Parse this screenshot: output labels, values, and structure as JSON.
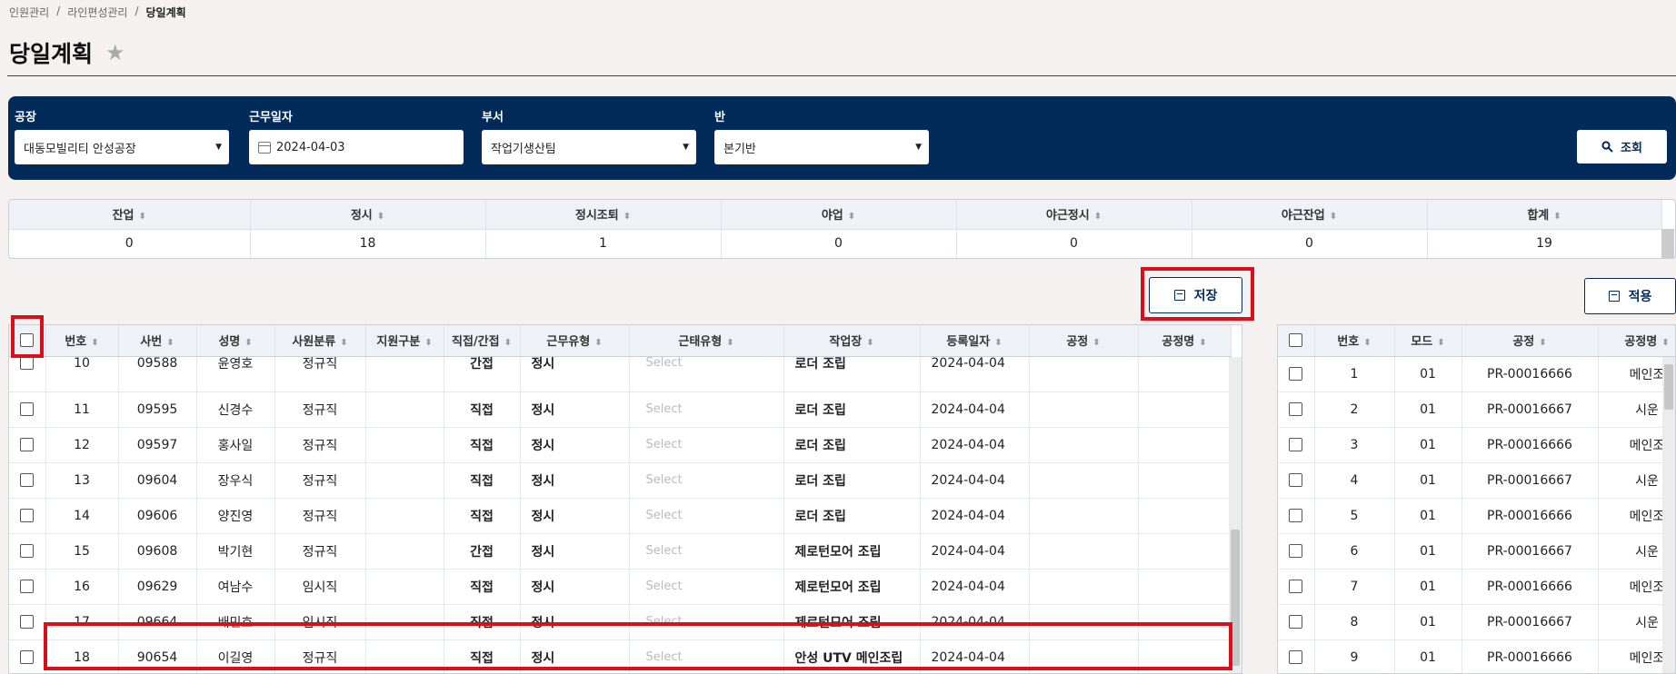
{
  "breadcrumb": [
    "인원관리",
    "라인편성관리",
    "당일계획"
  ],
  "page": {
    "title": "당일계획"
  },
  "filters": {
    "factory": {
      "label": "공장",
      "value": "대동모빌리티 안성공장"
    },
    "work_date": {
      "label": "근무일자",
      "value": "2024-04-03"
    },
    "department": {
      "label": "부서",
      "value": "작업기생산팀"
    },
    "team": {
      "label": "반",
      "value": "본기반"
    },
    "search_label": "조회"
  },
  "summary": {
    "headers": [
      "잔업",
      "정시",
      "정시조퇴",
      "야업",
      "야근정시",
      "야근잔업",
      "합계"
    ],
    "values": [
      "0",
      "18",
      "1",
      "0",
      "0",
      "0",
      "19"
    ]
  },
  "buttons": {
    "save": "저장",
    "apply": "적용"
  },
  "main_table": {
    "headers": [
      "번호",
      "사번",
      "성명",
      "사원분류",
      "지원구분",
      "직접/간접",
      "근무유형",
      "근태유형",
      "작업장",
      "등록일자",
      "공정",
      "공정명"
    ],
    "select_placeholder": "Select",
    "rows": [
      {
        "no": "10",
        "emp_id": "09588",
        "name": "윤영호",
        "class": "정규직",
        "support": "",
        "type": "간접",
        "work": "정시",
        "attend": "Select",
        "workplace": "로더 조립",
        "date": "2024-04-04",
        "proc": "",
        "proc_name": ""
      },
      {
        "no": "11",
        "emp_id": "09595",
        "name": "신경수",
        "class": "정규직",
        "support": "",
        "type": "직접",
        "work": "정시",
        "attend": "Select",
        "workplace": "로더 조립",
        "date": "2024-04-04",
        "proc": "",
        "proc_name": ""
      },
      {
        "no": "12",
        "emp_id": "09597",
        "name": "홍사일",
        "class": "정규직",
        "support": "",
        "type": "직접",
        "work": "정시",
        "attend": "Select",
        "workplace": "로더 조립",
        "date": "2024-04-04",
        "proc": "",
        "proc_name": ""
      },
      {
        "no": "13",
        "emp_id": "09604",
        "name": "장우식",
        "class": "정규직",
        "support": "",
        "type": "직접",
        "work": "정시",
        "attend": "Select",
        "workplace": "로더 조립",
        "date": "2024-04-04",
        "proc": "",
        "proc_name": ""
      },
      {
        "no": "14",
        "emp_id": "09606",
        "name": "양진영",
        "class": "정규직",
        "support": "",
        "type": "직접",
        "work": "정시",
        "attend": "Select",
        "workplace": "로더 조립",
        "date": "2024-04-04",
        "proc": "",
        "proc_name": ""
      },
      {
        "no": "15",
        "emp_id": "09608",
        "name": "박기현",
        "class": "정규직",
        "support": "",
        "type": "간접",
        "work": "정시",
        "attend": "Select",
        "workplace": "제로턴모어 조립",
        "date": "2024-04-04",
        "proc": "",
        "proc_name": ""
      },
      {
        "no": "16",
        "emp_id": "09629",
        "name": "여남수",
        "class": "임시직",
        "support": "",
        "type": "직접",
        "work": "정시",
        "attend": "Select",
        "workplace": "제로턴모어 조립",
        "date": "2024-04-04",
        "proc": "",
        "proc_name": ""
      },
      {
        "no": "17",
        "emp_id": "09664",
        "name": "배민호",
        "class": "임시직",
        "support": "",
        "type": "직접",
        "work": "정시",
        "attend": "Select",
        "workplace": "제로턴모어 조립",
        "date": "2024-04-04",
        "proc": "",
        "proc_name": ""
      },
      {
        "no": "18",
        "emp_id": "90654",
        "name": "이길영",
        "class": "정규직",
        "support": "",
        "type": "직접",
        "work": "정시",
        "attend": "Select",
        "workplace": "안성 UTV 메인조립",
        "date": "2024-04-04",
        "proc": "",
        "proc_name": ""
      }
    ]
  },
  "side_table": {
    "headers": [
      "번호",
      "모드",
      "공정",
      "공정명"
    ],
    "rows": [
      {
        "no": "1",
        "mode": "01",
        "proc": "PR-00016666",
        "name": "메인조"
      },
      {
        "no": "2",
        "mode": "01",
        "proc": "PR-00016667",
        "name": "시운"
      },
      {
        "no": "3",
        "mode": "01",
        "proc": "PR-00016666",
        "name": "메인조"
      },
      {
        "no": "4",
        "mode": "01",
        "proc": "PR-00016667",
        "name": "시운"
      },
      {
        "no": "5",
        "mode": "01",
        "proc": "PR-00016666",
        "name": "메인조"
      },
      {
        "no": "6",
        "mode": "01",
        "proc": "PR-00016667",
        "name": "시운"
      },
      {
        "no": "7",
        "mode": "01",
        "proc": "PR-00016666",
        "name": "메인조"
      },
      {
        "no": "8",
        "mode": "01",
        "proc": "PR-00016667",
        "name": "시운"
      },
      {
        "no": "9",
        "mode": "01",
        "proc": "PR-00016666",
        "name": "메인조"
      }
    ]
  }
}
